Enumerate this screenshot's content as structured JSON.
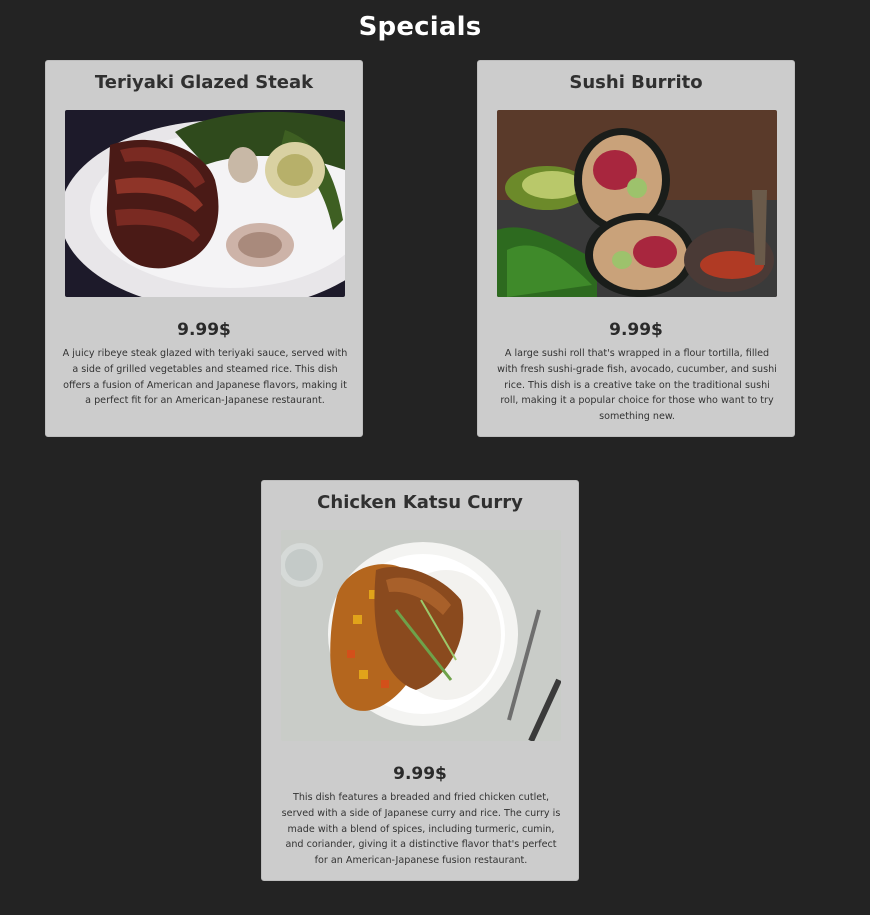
{
  "page": {
    "title": "Specials"
  },
  "specials": [
    {
      "name": "Teriyaki Glazed Steak",
      "price": "9.99$",
      "description": "A juicy ribeye steak glazed with teriyaki sauce, served with a side of grilled vegetables and steamed rice. This dish offers a fusion of American and Japanese flavors, making it a perfect fit for an American-Japanese restaurant.",
      "image": "teriyaki-steak-photo"
    },
    {
      "name": "Sushi Burrito",
      "price": "9.99$",
      "description": "A large sushi roll that's wrapped in a flour tortilla, filled with fresh sushi-grade fish, avocado, cucumber, and sushi rice. This dish is a creative take on the traditional sushi roll, making it a popular choice for those who want to try something new.",
      "image": "sushi-burrito-photo"
    },
    {
      "name": "Chicken Katsu Curry",
      "price": "9.99$",
      "description": "This dish features a breaded and fried chicken cutlet, served with a side of Japanese curry and rice. The curry is made with a blend of spices, including turmeric, cumin, and coriander, giving it a distinctive flavor that's perfect for an American-Japanese fusion restaurant.",
      "image": "chicken-katsu-curry-photo"
    }
  ],
  "colors": {
    "background": "#232323",
    "card": "#cccccc",
    "title": "#ffffff",
    "text": "#333333"
  }
}
